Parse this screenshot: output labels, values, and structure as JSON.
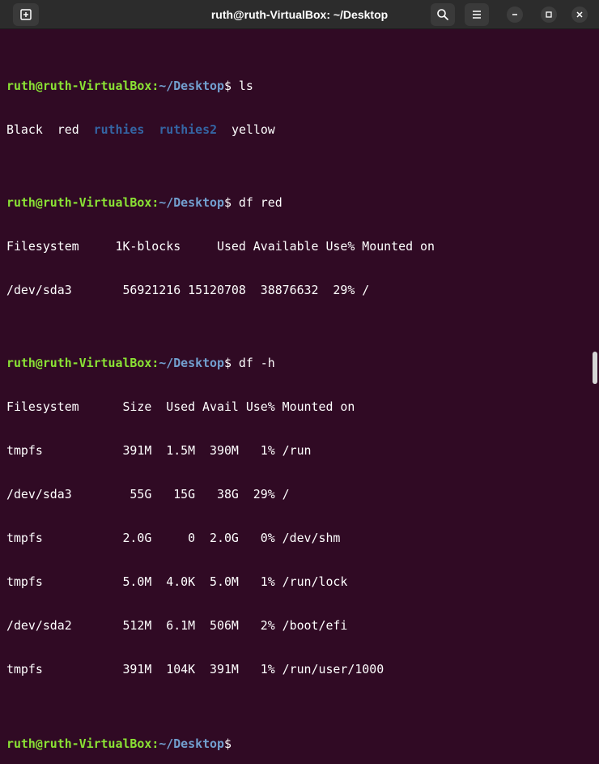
{
  "window": {
    "title": "ruth@ruth-VirtualBox: ~/Desktop"
  },
  "icons": {
    "new_tab": "new-tab-icon",
    "search": "search-icon",
    "menu": "hamburger-menu-icon",
    "minimize": "minimize-icon",
    "maximize": "maximize-icon",
    "close": "close-icon"
  },
  "prompt": {
    "user_host": "ruth@ruth-VirtualBox",
    "path": "~/Desktop",
    "symbol": "$"
  },
  "commands": {
    "c1": " ls",
    "c2": " df red",
    "c3": " df -h",
    "c4": ""
  },
  "ls_output": {
    "black": "Black",
    "red": "red",
    "ruthies": "ruthies",
    "ruthies2": "ruthies2",
    "yellow": "yellow"
  },
  "df_red_output": {
    "header": "Filesystem     1K-blocks     Used Available Use% Mounted on",
    "row1": "/dev/sda3       56921216 15120708  38876632  29% /"
  },
  "df_h_output": {
    "header": "Filesystem      Size  Used Avail Use% Mounted on",
    "rows": [
      "tmpfs           391M  1.5M  390M   1% /run",
      "/dev/sda3        55G   15G   38G  29% /",
      "tmpfs           2.0G     0  2.0G   0% /dev/shm",
      "tmpfs           5.0M  4.0K  5.0M   1% /run/lock",
      "/dev/sda2       512M  6.1M  506M   2% /boot/efi",
      "tmpfs           391M  104K  391M   1% /run/user/1000"
    ]
  },
  "colors": {
    "background": "#300a24",
    "prompt_user": "#8ae234",
    "prompt_path": "#729fcf",
    "directory": "#3465a4",
    "text": "#ffffff"
  }
}
